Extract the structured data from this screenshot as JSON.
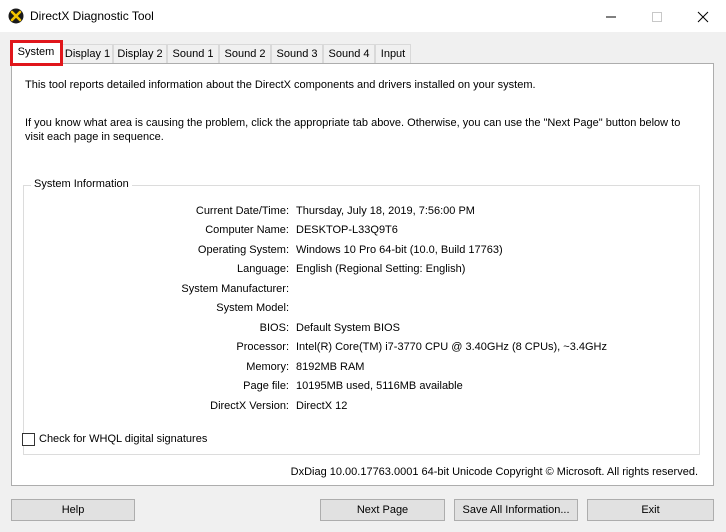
{
  "window": {
    "title": "DirectX Diagnostic Tool"
  },
  "tabs": [
    "System",
    "Display 1",
    "Display 2",
    "Sound 1",
    "Sound 2",
    "Sound 3",
    "Sound 4",
    "Input"
  ],
  "intro": {
    "line1": "This tool reports detailed information about the DirectX components and drivers installed on your system.",
    "line2": "If you know what area is causing the problem, click the appropriate tab above.  Otherwise, you can use the \"Next Page\" button below to visit each page in sequence."
  },
  "system_info": {
    "group_label": "System Information",
    "rows": [
      {
        "label": "Current Date/Time:",
        "value": "Thursday, July 18, 2019, 7:56:00 PM"
      },
      {
        "label": "Computer Name:",
        "value": "DESKTOP-L33Q9T6"
      },
      {
        "label": "Operating System:",
        "value": "Windows 10 Pro 64-bit (10.0, Build 17763)"
      },
      {
        "label": "Language:",
        "value": "English (Regional Setting: English)"
      },
      {
        "label": "System Manufacturer:",
        "value": ""
      },
      {
        "label": "System Model:",
        "value": ""
      },
      {
        "label": "BIOS:",
        "value": "Default System BIOS"
      },
      {
        "label": "Processor:",
        "value": "Intel(R) Core(TM) i7-3770 CPU @ 3.40GHz (8 CPUs), ~3.4GHz"
      },
      {
        "label": "Memory:",
        "value": "8192MB RAM"
      },
      {
        "label": "Page file:",
        "value": "10195MB used, 5116MB available"
      },
      {
        "label": "DirectX Version:",
        "value": "DirectX 12"
      }
    ]
  },
  "whql_checkbox": {
    "label": "Check for WHQL digital signatures",
    "checked": false
  },
  "copyright": "DxDiag 10.00.17763.0001 64-bit Unicode  Copyright © Microsoft. All rights reserved.",
  "buttons": {
    "help": "Help",
    "next_page": "Next Page",
    "save_all": "Save All Information...",
    "exit": "Exit"
  },
  "colors": {
    "highlight": "#e0161b",
    "panel_bg": "#ffffff",
    "window_bg": "#f0f0f0"
  }
}
